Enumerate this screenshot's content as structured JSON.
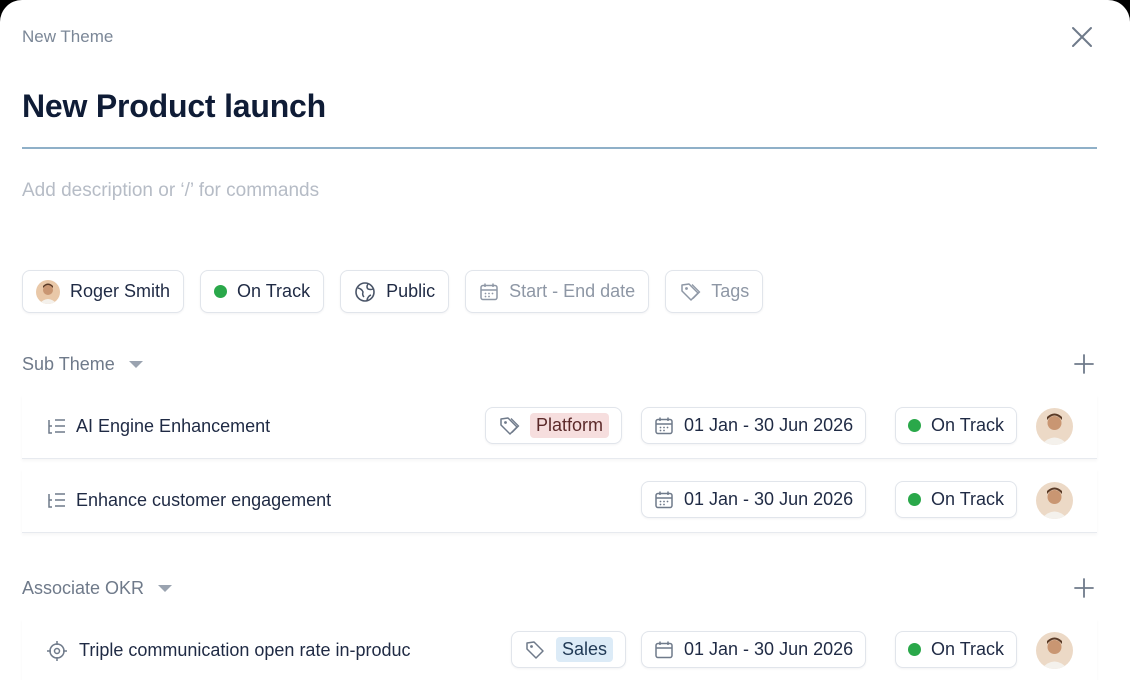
{
  "header": {
    "breadcrumb": "New Theme",
    "title": "New Product launch",
    "description_placeholder": "Add description or ‘/’ for commands"
  },
  "chips": {
    "owner": "Roger Smith",
    "status": "On Track",
    "visibility": "Public",
    "date": "Start - End date",
    "tags": "Tags"
  },
  "sub_theme": {
    "label": "Sub Theme",
    "rows": [
      {
        "name": "AI Engine Enhancement",
        "tag": "Platform",
        "date": "01 Jan - 30 Jun 2026",
        "status": "On Track"
      },
      {
        "name": "Enhance customer engagement",
        "date": "01 Jan - 30 Jun 2026",
        "status": "On Track"
      }
    ]
  },
  "associate_okr": {
    "label": "Associate OKR",
    "rows": [
      {
        "name": "Triple communication open rate in-produc",
        "tag": "Sales",
        "date": "01 Jan - 30 Jun 2026",
        "status": "On Track"
      }
    ]
  },
  "colors": {
    "status_green": "#2aa84a",
    "title_underline": "#8fb0c8",
    "platform_tag_bg": "#f6dede",
    "sales_tag_bg": "#dcebf7"
  }
}
